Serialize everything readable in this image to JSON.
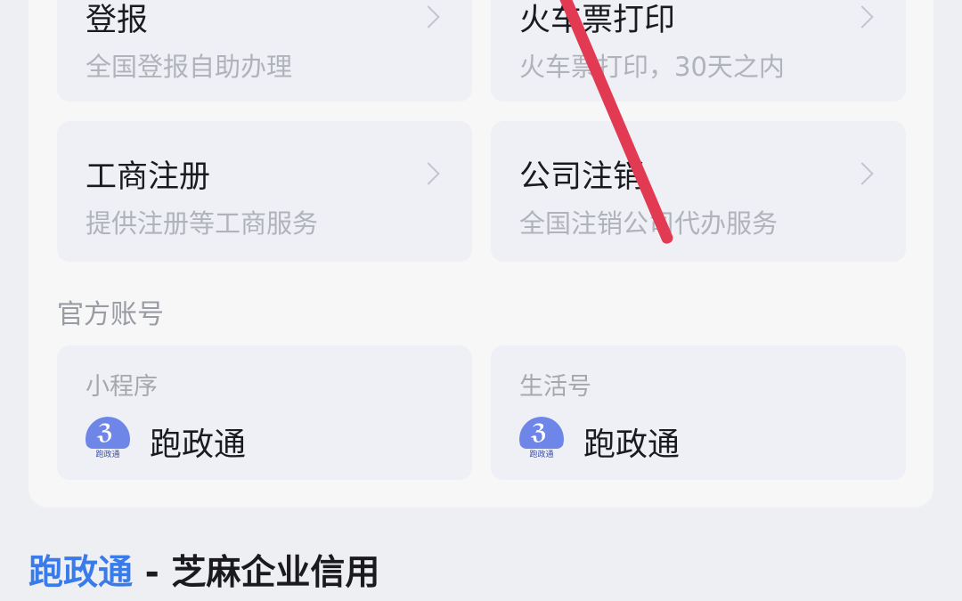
{
  "services": [
    {
      "title": "登报",
      "subtitle": "全国登报自助办理"
    },
    {
      "title": "火车票打印",
      "subtitle": "火车票打印，30天之内"
    },
    {
      "title": "工商注册",
      "subtitle": "提供注册等工商服务"
    },
    {
      "title": "公司注销",
      "subtitle": "全国注销公司代办服务"
    }
  ],
  "official_accounts": {
    "label": "官方账号",
    "items": [
      {
        "type": "小程序",
        "name": "跑政通",
        "logo_text": "跑政通",
        "icon": "runner-logo-icon"
      },
      {
        "type": "生活号",
        "name": "跑政通",
        "logo_text": "跑政通",
        "icon": "runner-logo-icon"
      }
    ]
  },
  "footer": {
    "brand": "跑政通",
    "rest": " - 芝麻企业信用"
  },
  "colors": {
    "brand": "#3a7bea",
    "tile_bg": "#eef0f5",
    "card_bg": "#f7f7f8",
    "page_bg": "#eeeff3",
    "annotation": "#e23a52",
    "logo": "#6d86e8"
  }
}
